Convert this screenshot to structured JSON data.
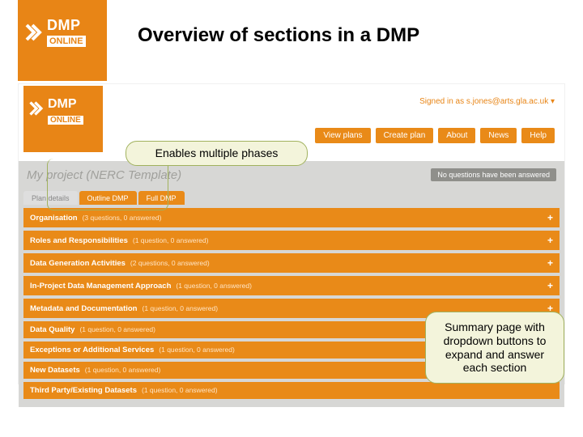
{
  "slide": {
    "title": "Overview of sections in a DMP"
  },
  "logo": {
    "brand_top": "DMP",
    "brand_bottom": "ONLINE"
  },
  "screenshot": {
    "signed_in": "Signed in as s.jones@arts.gla.ac.uk ▾",
    "nav": [
      "View plans",
      "Create plan",
      "About",
      "News",
      "Help"
    ],
    "project_title": "My project (NERC Template)",
    "status_text": "No questions have been answered",
    "tabs": [
      {
        "label": "Plan details",
        "active": false
      },
      {
        "label": "Outline DMP",
        "active": true
      },
      {
        "label": "Full DMP",
        "active": true
      }
    ],
    "sections": [
      {
        "title": "Organisation",
        "meta": "(3 questions, 0 answered)",
        "plus": "+"
      },
      {
        "title": "Roles and Responsibilities",
        "meta": "(1 question, 0 answered)",
        "plus": "+"
      },
      {
        "title": "Data Generation Activities",
        "meta": "(2 questions, 0 answered)",
        "plus": "+"
      },
      {
        "title": "In-Project Data Management Approach",
        "meta": "(1 question, 0 answered)",
        "plus": "+"
      },
      {
        "title": "Metadata and Documentation",
        "meta": "(1 question, 0 answered)",
        "plus": "+"
      },
      {
        "title": "Data Quality",
        "meta": "(1 question, 0 answered)",
        "plus": ""
      },
      {
        "title": "Exceptions or Additional Services",
        "meta": "(1 question, 0 answered)",
        "plus": ""
      },
      {
        "title": "New Datasets",
        "meta": "(1 question, 0 answered)",
        "plus": ""
      },
      {
        "title": "Third Party/Existing Datasets",
        "meta": "(1 question, 0 answered)",
        "plus": ""
      }
    ]
  },
  "callouts": {
    "phases": "Enables multiple phases",
    "summary": "Summary page with dropdown buttons to expand and answer each section"
  }
}
